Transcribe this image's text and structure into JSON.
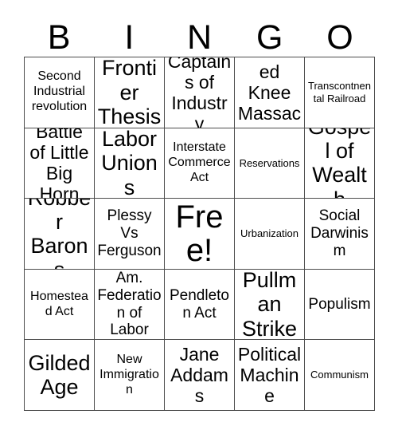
{
  "card": {
    "header_letters": [
      "B",
      "I",
      "N",
      "G",
      "O"
    ],
    "rows": [
      [
        {
          "text": "Second Industrial revolution",
          "size": "sm"
        },
        {
          "text": "Frontier Thesis",
          "size": "xl"
        },
        {
          "text": "Captains of Industry",
          "size": "lg"
        },
        {
          "text": "Wounded Knee Massacre",
          "size": "lg"
        },
        {
          "text": "Transcontnental Railroad",
          "size": "xs"
        }
      ],
      [
        {
          "text": "Battle of Little Big Horn",
          "size": "lg"
        },
        {
          "text": "Labor Unions",
          "size": "xl"
        },
        {
          "text": "Interstate Commerce Act",
          "size": "sm"
        },
        {
          "text": "Reservations",
          "size": "xs"
        },
        {
          "text": "Gospel of Wealth",
          "size": "xl"
        }
      ],
      [
        {
          "text": "Robber Barons",
          "size": "xl"
        },
        {
          "text": "Plessy Vs Ferguson",
          "size": "md"
        },
        {
          "text": "Free!",
          "size": "xxl"
        },
        {
          "text": "Urbanization",
          "size": "xs"
        },
        {
          "text": "Social Darwinism",
          "size": "md"
        }
      ],
      [
        {
          "text": "Homestead Act",
          "size": "sm"
        },
        {
          "text": "Am. Federation of Labor",
          "size": "md"
        },
        {
          "text": "Pendleton Act",
          "size": "md"
        },
        {
          "text": "Pullman Strike",
          "size": "xl"
        },
        {
          "text": "Populism",
          "size": "md"
        }
      ],
      [
        {
          "text": "Gilded Age",
          "size": "xl"
        },
        {
          "text": "New Immigration",
          "size": "sm"
        },
        {
          "text": "Jane Addams",
          "size": "lg"
        },
        {
          "text": "Political Machine",
          "size": "lg"
        },
        {
          "text": "Communism",
          "size": "xs"
        }
      ]
    ],
    "free_space": {
      "row": 2,
      "col": 2,
      "label": "Free!"
    },
    "colors": {
      "background": "#ffffff",
      "text": "#000000",
      "grid_line": "#4d4d4d"
    }
  }
}
